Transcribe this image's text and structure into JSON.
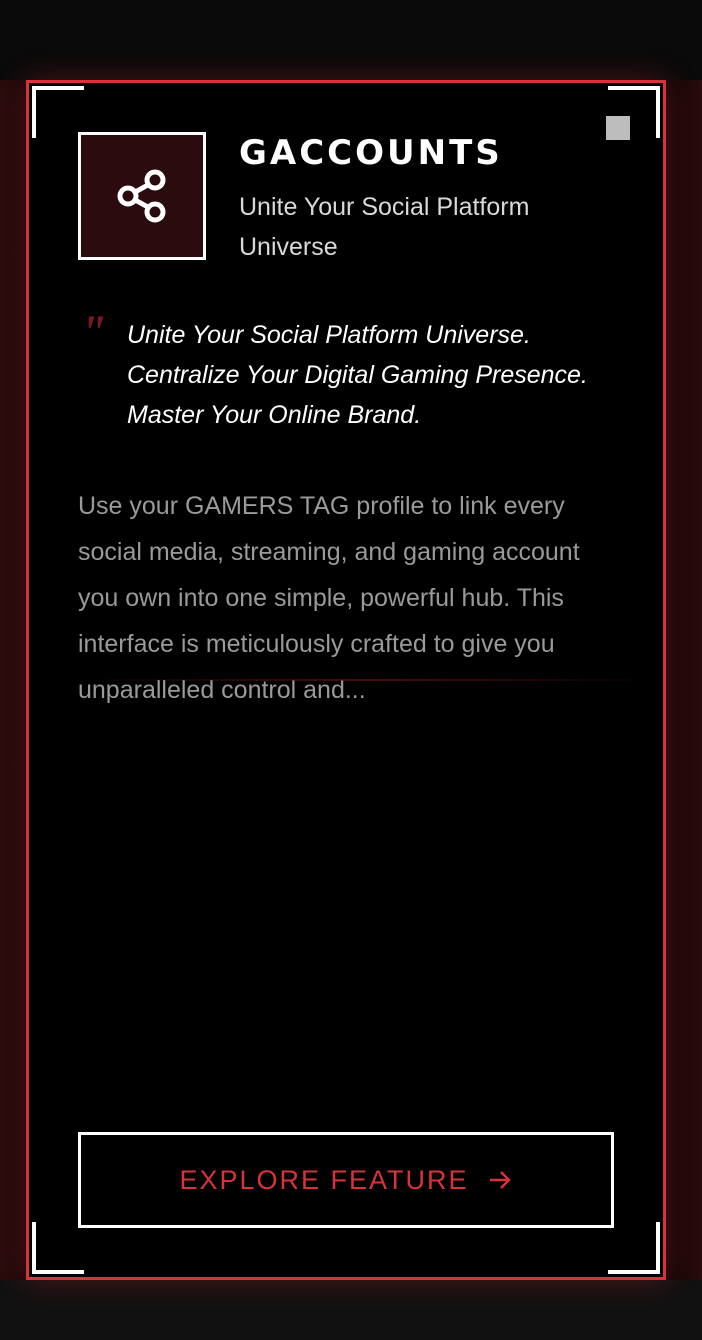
{
  "card": {
    "title": "GACCOUNTS",
    "subtitle": "Unite Your Social Platform Universe",
    "icon": "share-icon",
    "quote_mark": "\"",
    "quote": "Unite Your Social Platform Universe. Centralize Your Digital Gaming Presence. Master Your Online Brand.",
    "description": "Use your GAMERS TAG profile to link every social media, streaming, and gaming account you own into one simple, powerful hub. This interface is meticulously crafted to give you unparalleled control and...",
    "button_label": "EXPLORE FEATURE",
    "button_icon": "arrow-right-icon"
  },
  "colors": {
    "accent": "#d8323a",
    "icon_bg": "#2b0b0d",
    "card_bg": "#000000",
    "text_primary": "#ffffff",
    "text_muted": "#9a9a9a"
  }
}
